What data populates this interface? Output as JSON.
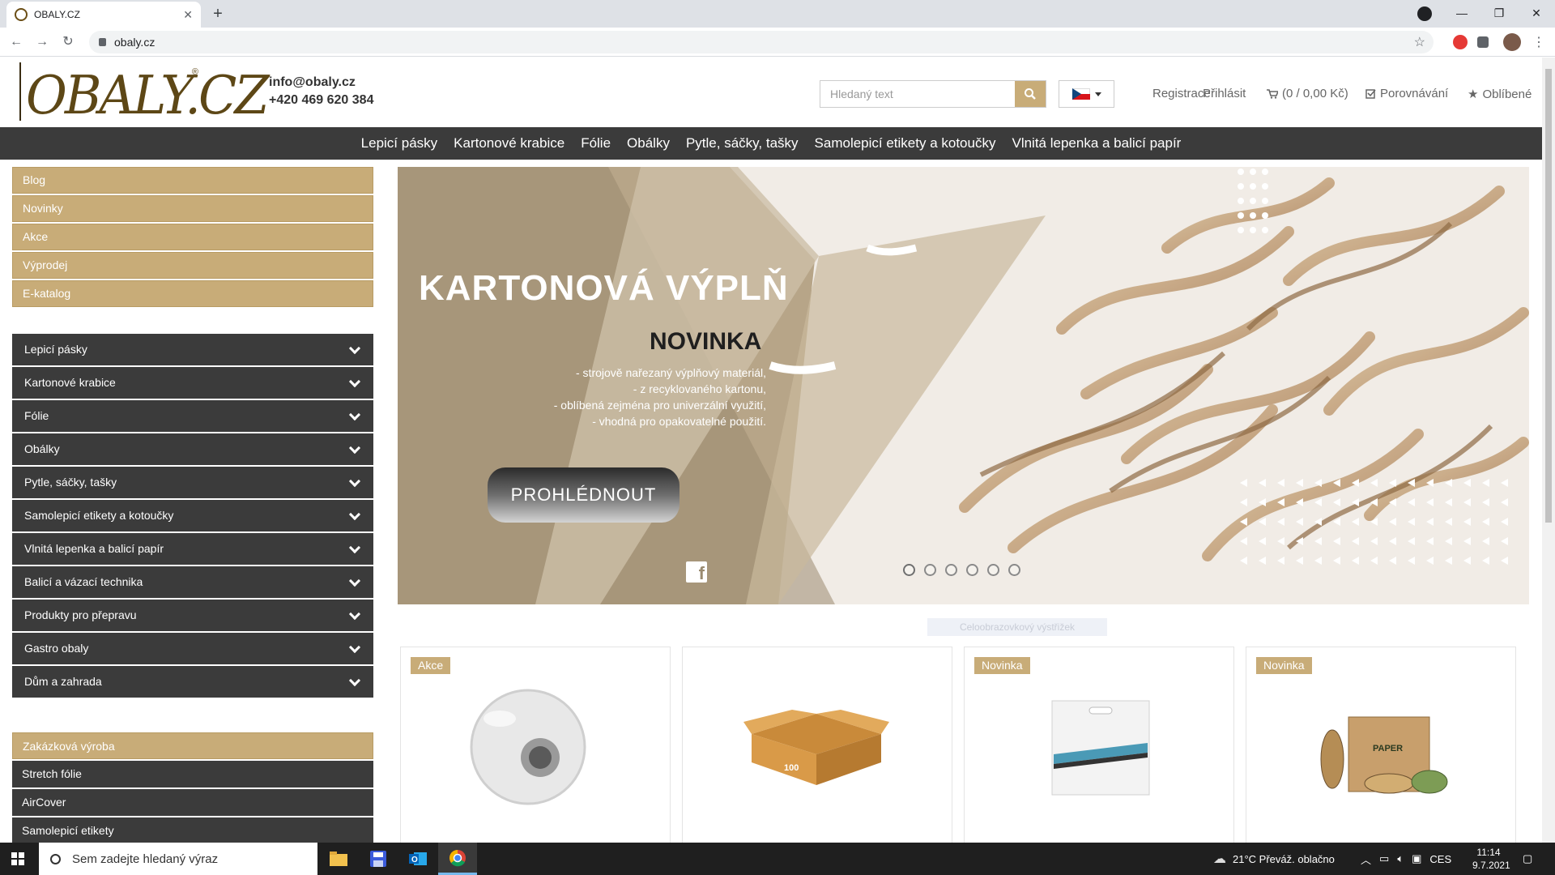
{
  "browser": {
    "tab_title": "OBALY.CZ",
    "url": "obaly.cz"
  },
  "header": {
    "logo": "OBALY.CZ",
    "email": "info@obaly.cz",
    "phone": "+420 469 620 384",
    "search_placeholder": "Hledaný text",
    "links": {
      "register": "Registrace",
      "login": "Přihlásit",
      "cart": "(0 / 0,00 Kč)",
      "compare": "Porovnávání",
      "favorites": "Oblíbené"
    }
  },
  "main_nav": [
    "Lepicí pásky",
    "Kartonové krabice",
    "Fólie",
    "Obálky",
    "Pytle, sáčky, tašky",
    "Samolepicí etikety a kotoučky",
    "Vlnitá lepenka a balicí papír"
  ],
  "sidebar_top": [
    "Blog",
    "Novinky",
    "Akce",
    "Výprodej",
    "E-katalog"
  ],
  "sidebar_categories": [
    "Lepicí pásky",
    "Kartonové krabice",
    "Fólie",
    "Obálky",
    "Pytle, sáčky, tašky",
    "Samolepicí etikety a kotoučky",
    "Vlnitá lepenka a balicí papír",
    "Balicí a vázací technika",
    "Produkty pro přepravu",
    "Gastro obaly",
    "Dům a zahrada"
  ],
  "sidebar_bottom": [
    "Zakázková výroba",
    "Stretch fólie",
    "AirCover",
    "Samolepicí etikety"
  ],
  "banner": {
    "title": "KARTONOVÁ VÝPLŇ",
    "subtitle": "NOVINKA",
    "bullets": [
      "- strojově nařezaný výplňový materiál,",
      "- z  recyklovaného kartonu,",
      "- oblíbená zejména pro univerzální využití,",
      "- vhodná pro opakovatelné použití."
    ],
    "button": "PROHLÉDNOUT",
    "slides_count": 6,
    "active_slide": 0,
    "caption": "Celoobrazovkový výstřižek"
  },
  "products": [
    {
      "badge": "Akce",
      "image": "tape-roll"
    },
    {
      "badge": "",
      "image": "cardboard-box",
      "box_label": "100"
    },
    {
      "badge": "Novinka",
      "image": "plastic-bag"
    },
    {
      "badge": "Novinka",
      "image": "paper-tape-set",
      "box_label": "PAPER"
    }
  ],
  "taskbar": {
    "search_placeholder": "Sem zadejte hledaný výraz",
    "weather": "21°C  Převáž. oblačno",
    "lang": "CES",
    "time": "11:14",
    "date": "9.7.2021"
  },
  "colors": {
    "gold": "#c8ac78",
    "dark": "#3b3b3b"
  }
}
